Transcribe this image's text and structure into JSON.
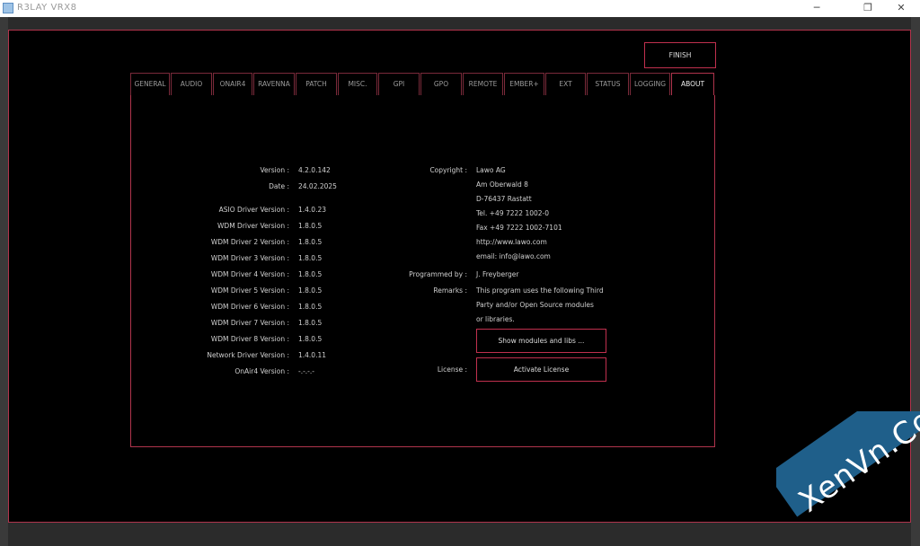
{
  "window": {
    "title": "R3LAY VRX8",
    "minimize": "─",
    "maximize": "❐",
    "close": "✕"
  },
  "finish_label": "FINISH",
  "tabs": [
    "GENERAL",
    "AUDIO",
    "ONAIR4",
    "RAVENNA",
    "PATCH",
    "MISC.",
    "GPI",
    "GPO",
    "REMOTE",
    "EMBER+",
    "EXT",
    "STATUS",
    "LOGGING",
    "ABOUT"
  ],
  "active_tab": "ABOUT",
  "left_info": [
    {
      "label": "Version :",
      "value": "4.2.0.142"
    },
    {
      "label": "Date :",
      "value": "24.02.2025"
    },
    {
      "label": "ASIO Driver Version :",
      "value": "1.4.0.23"
    },
    {
      "label": "WDM Driver Version :",
      "value": "1.8.0.5"
    },
    {
      "label": "WDM Driver 2 Version :",
      "value": "1.8.0.5"
    },
    {
      "label": "WDM Driver 3 Version :",
      "value": "1.8.0.5"
    },
    {
      "label": "WDM Driver 4 Version :",
      "value": "1.8.0.5"
    },
    {
      "label": "WDM Driver 5 Version :",
      "value": "1.8.0.5"
    },
    {
      "label": "WDM Driver 6 Version :",
      "value": "1.8.0.5"
    },
    {
      "label": "WDM Driver 7 Version :",
      "value": "1.8.0.5"
    },
    {
      "label": "WDM Driver 8 Version :",
      "value": "1.8.0.5"
    },
    {
      "label": "Network Driver Version :",
      "value": "1.4.0.11"
    },
    {
      "label": "OnAir4 Version :",
      "value": "-.-.-.-"
    }
  ],
  "copyright": {
    "label": "Copyright :",
    "lines": [
      "Lawo AG",
      "Am Oberwald 8",
      "D-76437 Rastatt",
      "Tel. +49 7222 1002-0",
      "Fax +49 7222 1002-7101",
      "http://www.lawo.com",
      "email: info@lawo.com"
    ]
  },
  "programmed": {
    "label": "Programmed by :",
    "value": "J. Freyberger"
  },
  "remarks": {
    "label": "Remarks :",
    "lines": [
      "This program uses the following Third",
      "Party and/or Open Source modules",
      "or libraries."
    ]
  },
  "show_modules_label": "Show modules and libs ...",
  "license": {
    "label": "License :",
    "button": "Activate License"
  },
  "watermark": "XenVn.Com",
  "colors": {
    "accent": "#b0344c",
    "background": "#000000"
  }
}
